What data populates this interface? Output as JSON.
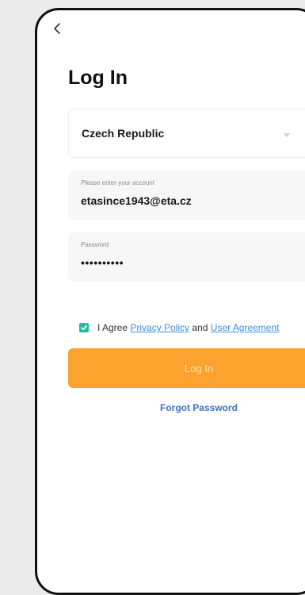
{
  "header": {
    "back_icon": "chevron-left-icon",
    "title": "Log In"
  },
  "form": {
    "country": {
      "value": "Czech Republic",
      "icon": "caret-down-icon"
    },
    "account": {
      "label": "Please enter your account",
      "value": "etasince1943@eta.cz"
    },
    "password": {
      "label": "Password",
      "value": "••••••••••"
    }
  },
  "agreement": {
    "checked": true,
    "prefix": "I Agree",
    "privacy_link": "Privacy Policy",
    "conjunction": "and",
    "user_agreement_link": "User Agreement"
  },
  "actions": {
    "login_label": "Log In",
    "forgot_label": "Forgot Password"
  },
  "colors": {
    "accent": "#fca32f",
    "link": "#3b8fe6",
    "checkbox": "#1bbfa1"
  }
}
